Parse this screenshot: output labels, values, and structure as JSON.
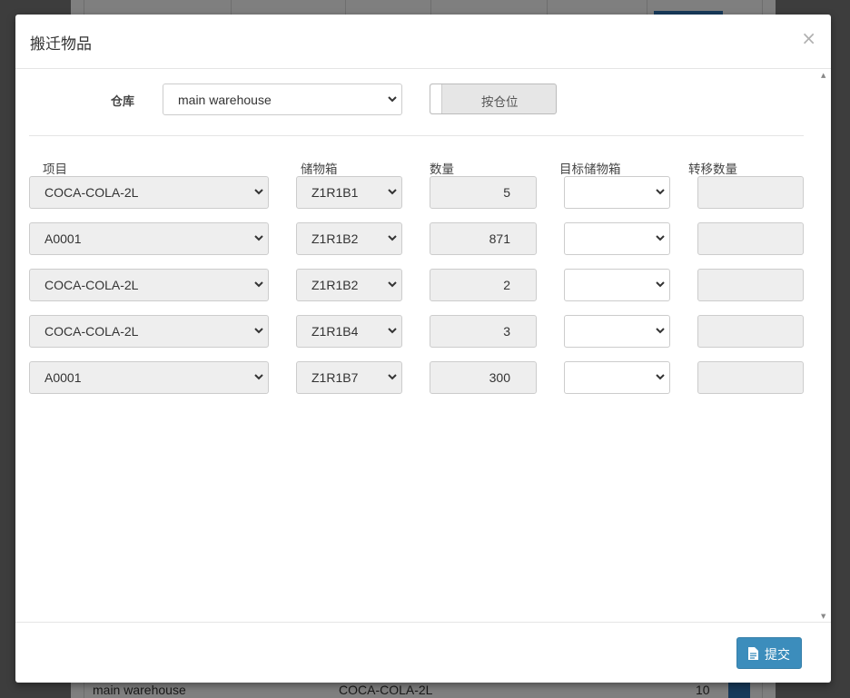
{
  "background": {
    "rows": [
      {
        "warehouse": "main warehouse",
        "item": "COCA-COLA-2L",
        "qty": "10"
      }
    ]
  },
  "modal": {
    "title": "搬迁物品",
    "close_label": "×",
    "warehouse_label": "仓库",
    "warehouse_value": "main warehouse",
    "toggle_label": "按仓位",
    "columns": {
      "item": "项目",
      "bin": "储物箱",
      "qty": "数量",
      "target_bin": "目标储物箱",
      "transfer_qty": "转移数量"
    },
    "rows": [
      {
        "item": "COCA-COLA-2L",
        "bin": "Z1R1B1",
        "qty": "5",
        "target_bin": "",
        "transfer_qty": ""
      },
      {
        "item": "A0001",
        "bin": "Z1R1B2",
        "qty": "871",
        "target_bin": "",
        "transfer_qty": ""
      },
      {
        "item": "COCA-COLA-2L",
        "bin": "Z1R1B2",
        "qty": "2",
        "target_bin": "",
        "transfer_qty": ""
      },
      {
        "item": "COCA-COLA-2L",
        "bin": "Z1R1B4",
        "qty": "3",
        "target_bin": "",
        "transfer_qty": ""
      },
      {
        "item": "A0001",
        "bin": "Z1R1B7",
        "qty": "300",
        "target_bin": "",
        "transfer_qty": ""
      }
    ],
    "submit_label": "提交"
  },
  "colors": {
    "primary": "#3c8dbc",
    "overlay": "#000000",
    "disabled_bg": "#eeeeee"
  },
  "icons": [
    "close-icon",
    "chevron-down-icon",
    "file-icon",
    "eye-icon"
  ]
}
